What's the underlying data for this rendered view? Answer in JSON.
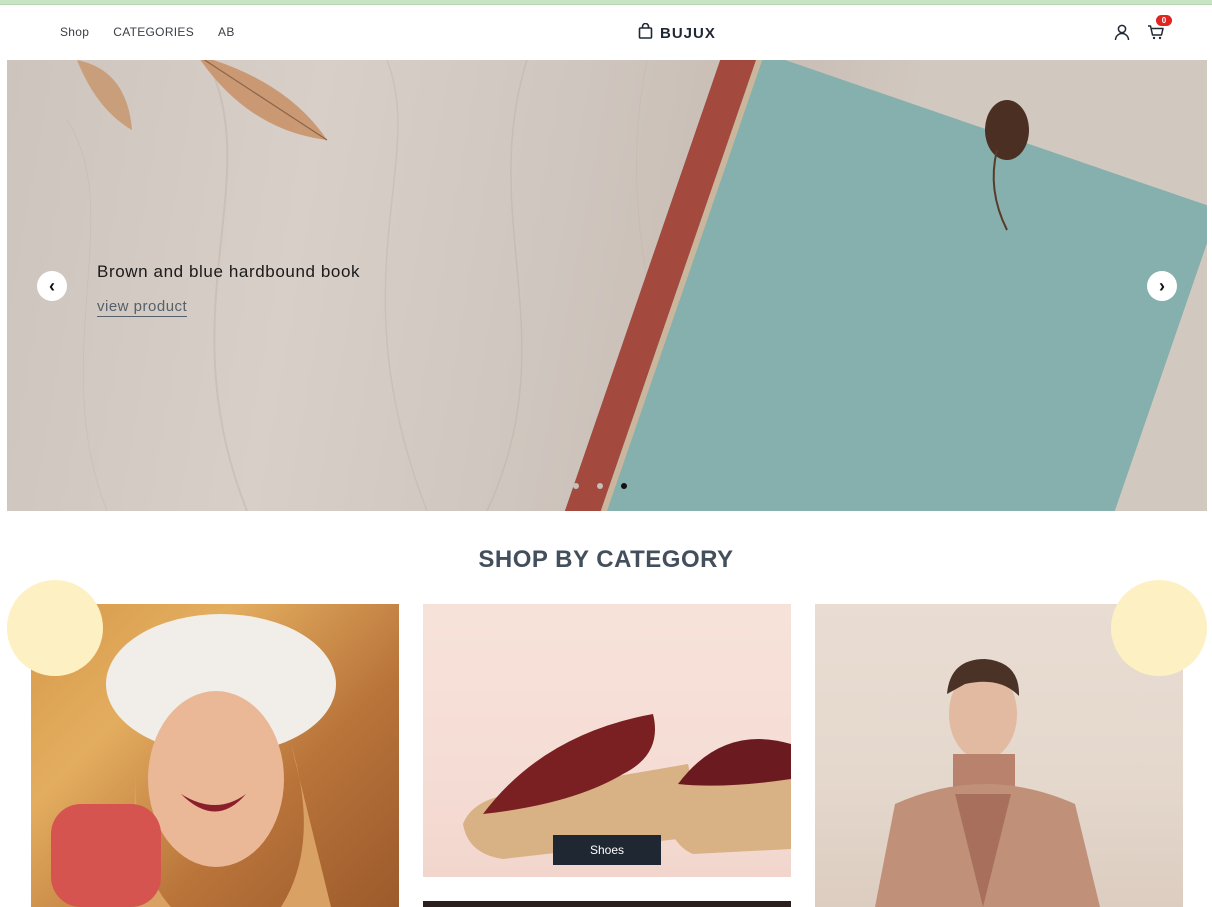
{
  "nav": {
    "links": [
      "Shop",
      "CATEGORIES",
      "AB"
    ],
    "brand": "BUJUX",
    "cart_count": "0",
    "icons": [
      "shopping-bag-icon",
      "user-icon",
      "cart-icon"
    ]
  },
  "hero": {
    "title": "Brown and blue hardbound book",
    "link_label": "view product",
    "prev_label": "‹",
    "next_label": "›",
    "slide_count": 3,
    "active_slide": 3
  },
  "section": {
    "title": "SHOP BY CATEGORY"
  },
  "categories": [
    {
      "label": "Shoes"
    }
  ],
  "colors": {
    "badge": "#e02424",
    "label_bg": "#1f2733",
    "deco_circle": "#fdf0c2",
    "title": "#434f5c"
  }
}
